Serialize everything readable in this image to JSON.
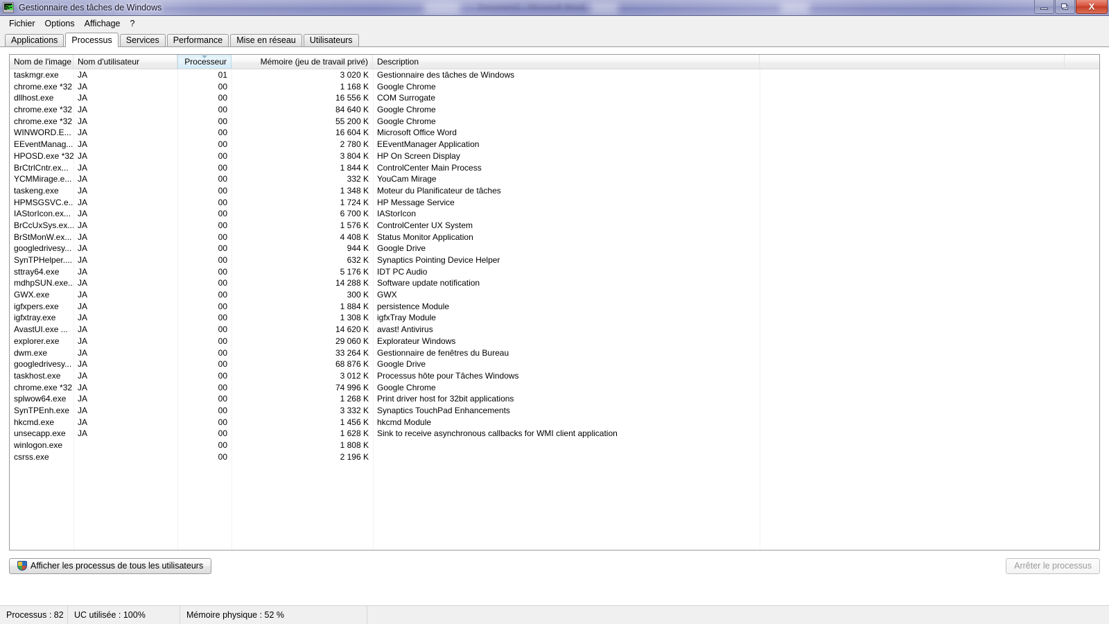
{
  "window": {
    "title": "Gestionnaire des tâches de Windows",
    "icon": "taskmgr-icon",
    "ghost_behind": "Document1 - Microsoft Word",
    "minimize_label": "—",
    "maximize_label": "❐",
    "close_label": "X"
  },
  "menubar": {
    "items": [
      {
        "label": "Fichier"
      },
      {
        "label": "Options"
      },
      {
        "label": "Affichage"
      },
      {
        "label": "?"
      }
    ]
  },
  "tabs": [
    {
      "label": "Applications",
      "active": false
    },
    {
      "label": "Processus",
      "active": true
    },
    {
      "label": "Services",
      "active": false
    },
    {
      "label": "Performance",
      "active": false
    },
    {
      "label": "Mise en réseau",
      "active": false
    },
    {
      "label": "Utilisateurs",
      "active": false
    }
  ],
  "table": {
    "sort_column": "Processeur",
    "sort_direction": "descending",
    "columns": [
      {
        "label": "Nom de l'image",
        "align": "left"
      },
      {
        "label": "Nom d'utilisateur",
        "align": "left"
      },
      {
        "label": "Processeur",
        "align": "right"
      },
      {
        "label": "Mémoire (jeu de travail privé)",
        "align": "right"
      },
      {
        "label": "Description",
        "align": "left"
      },
      {
        "label": "",
        "align": "left"
      }
    ],
    "rows": [
      {
        "name": "taskmgr.exe",
        "user": "JA",
        "cpu": "01",
        "mem": "3 020 K",
        "desc": "Gestionnaire des tâches de Windows"
      },
      {
        "name": "chrome.exe *32",
        "user": "JA",
        "cpu": "00",
        "mem": "1 168 K",
        "desc": "Google Chrome"
      },
      {
        "name": "dllhost.exe",
        "user": "JA",
        "cpu": "00",
        "mem": "16 556 K",
        "desc": "COM Surrogate"
      },
      {
        "name": "chrome.exe *32",
        "user": "JA",
        "cpu": "00",
        "mem": "84 640 K",
        "desc": "Google Chrome"
      },
      {
        "name": "chrome.exe *32",
        "user": "JA",
        "cpu": "00",
        "mem": "55 200 K",
        "desc": "Google Chrome"
      },
      {
        "name": "WINWORD.E...",
        "user": "JA",
        "cpu": "00",
        "mem": "16 604 K",
        "desc": "Microsoft Office Word"
      },
      {
        "name": "EEventManag...",
        "user": "JA",
        "cpu": "00",
        "mem": "2 780 K",
        "desc": "EEventManager Application"
      },
      {
        "name": "HPOSD.exe *32",
        "user": "JA",
        "cpu": "00",
        "mem": "3 804 K",
        "desc": "HP On Screen Display"
      },
      {
        "name": "BrCtrlCntr.ex...",
        "user": "JA",
        "cpu": "00",
        "mem": "1 844 K",
        "desc": "ControlCenter Main Process"
      },
      {
        "name": "YCMMirage.e...",
        "user": "JA",
        "cpu": "00",
        "mem": "332 K",
        "desc": "YouCam Mirage"
      },
      {
        "name": "taskeng.exe",
        "user": "JA",
        "cpu": "00",
        "mem": "1 348 K",
        "desc": "Moteur du Planificateur de tâches"
      },
      {
        "name": "HPMSGSVC.e...",
        "user": "JA",
        "cpu": "00",
        "mem": "1 724 K",
        "desc": "HP Message Service"
      },
      {
        "name": "IAStorIcon.ex...",
        "user": "JA",
        "cpu": "00",
        "mem": "6 700 K",
        "desc": "IAStorIcon"
      },
      {
        "name": "BrCcUxSys.ex...",
        "user": "JA",
        "cpu": "00",
        "mem": "1 576 K",
        "desc": "ControlCenter UX System"
      },
      {
        "name": "BrStMonW.ex...",
        "user": "JA",
        "cpu": "00",
        "mem": "4 408 K",
        "desc": "Status Monitor Application"
      },
      {
        "name": "googledrivesy...",
        "user": "JA",
        "cpu": "00",
        "mem": "944 K",
        "desc": "Google Drive"
      },
      {
        "name": "SynTPHelper....",
        "user": "JA",
        "cpu": "00",
        "mem": "632 K",
        "desc": "Synaptics Pointing Device Helper"
      },
      {
        "name": "sttray64.exe",
        "user": "JA",
        "cpu": "00",
        "mem": "5 176 K",
        "desc": "IDT PC Audio"
      },
      {
        "name": "mdhpSUN.exe...",
        "user": "JA",
        "cpu": "00",
        "mem": "14 288 K",
        "desc": "Software update notification"
      },
      {
        "name": "GWX.exe",
        "user": "JA",
        "cpu": "00",
        "mem": "300 K",
        "desc": "GWX"
      },
      {
        "name": "igfxpers.exe",
        "user": "JA",
        "cpu": "00",
        "mem": "1 884 K",
        "desc": "persistence Module"
      },
      {
        "name": "igfxtray.exe",
        "user": "JA",
        "cpu": "00",
        "mem": "1 308 K",
        "desc": "igfxTray Module"
      },
      {
        "name": "AvastUI.exe ...",
        "user": "JA",
        "cpu": "00",
        "mem": "14 620 K",
        "desc": "avast! Antivirus"
      },
      {
        "name": "explorer.exe",
        "user": "JA",
        "cpu": "00",
        "mem": "29 060 K",
        "desc": "Explorateur Windows"
      },
      {
        "name": "dwm.exe",
        "user": "JA",
        "cpu": "00",
        "mem": "33 264 K",
        "desc": "Gestionnaire de fenêtres du Bureau"
      },
      {
        "name": "googledrivesy...",
        "user": "JA",
        "cpu": "00",
        "mem": "68 876 K",
        "desc": "Google Drive"
      },
      {
        "name": "taskhost.exe",
        "user": "JA",
        "cpu": "00",
        "mem": "3 012 K",
        "desc": "Processus hôte pour Tâches Windows"
      },
      {
        "name": "chrome.exe *32",
        "user": "JA",
        "cpu": "00",
        "mem": "74 996 K",
        "desc": "Google Chrome"
      },
      {
        "name": "splwow64.exe",
        "user": "JA",
        "cpu": "00",
        "mem": "1 268 K",
        "desc": "Print driver host for 32bit applications"
      },
      {
        "name": "SynTPEnh.exe",
        "user": "JA",
        "cpu": "00",
        "mem": "3 332 K",
        "desc": "Synaptics TouchPad Enhancements"
      },
      {
        "name": "hkcmd.exe",
        "user": "JA",
        "cpu": "00",
        "mem": "1 456 K",
        "desc": "hkcmd Module"
      },
      {
        "name": "unsecapp.exe",
        "user": "JA",
        "cpu": "00",
        "mem": "1 628 K",
        "desc": "Sink to receive asynchronous callbacks for WMI client application"
      },
      {
        "name": "winlogon.exe",
        "user": "",
        "cpu": "00",
        "mem": "1 808 K",
        "desc": ""
      },
      {
        "name": "csrss.exe",
        "user": "",
        "cpu": "00",
        "mem": "2 196 K",
        "desc": ""
      }
    ]
  },
  "buttons": {
    "show_all_users": "Afficher les processus de tous les utilisateurs",
    "end_process": "Arrêter le processus"
  },
  "statusbar": {
    "processes": "Processus : 82",
    "cpu_usage": "UC utilisée : 100%",
    "physical_memory": "Mémoire physique : 52 %",
    "empty": ""
  }
}
